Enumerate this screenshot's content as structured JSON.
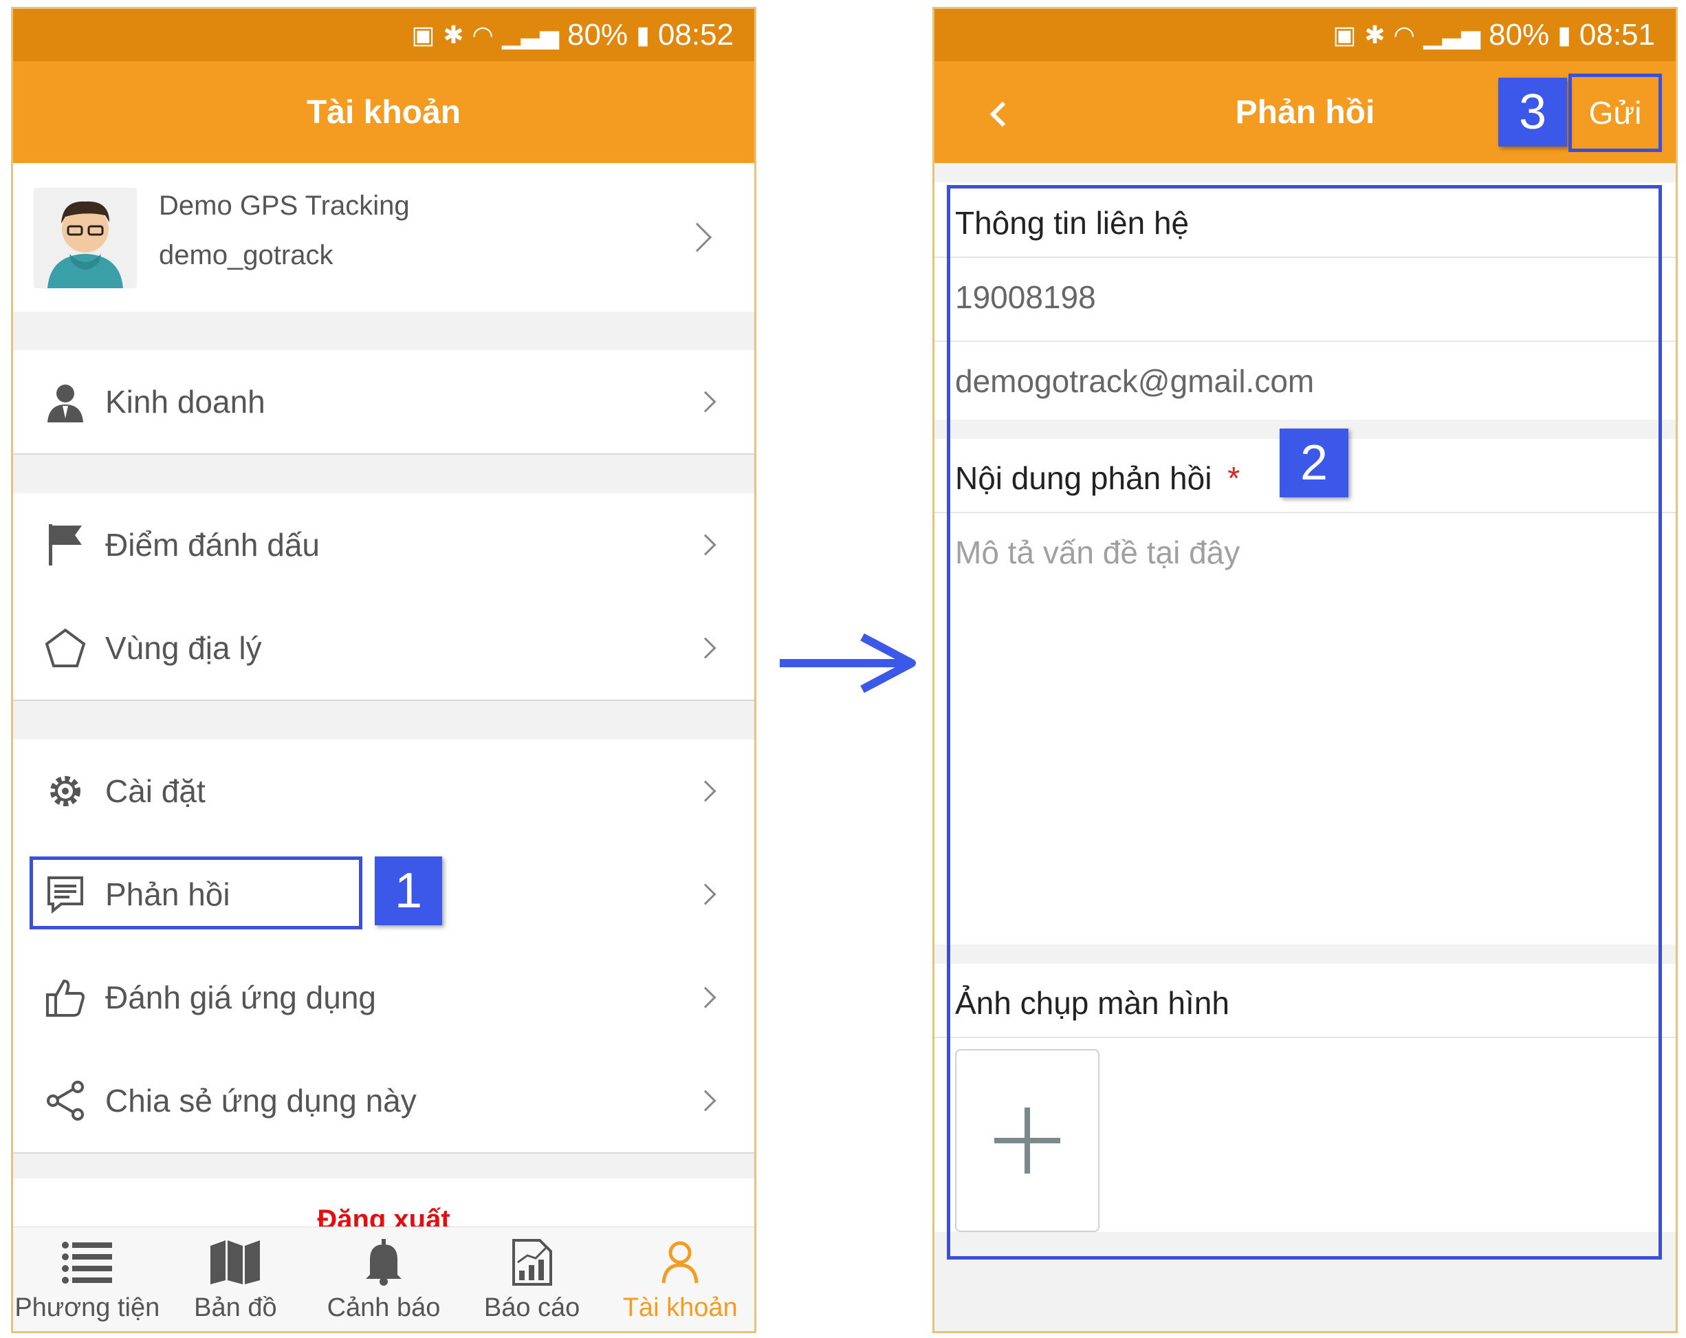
{
  "left": {
    "status": {
      "battery": "80%",
      "time": "08:52"
    },
    "title": "Tài khoản",
    "profile": {
      "name": "Demo GPS Tracking",
      "username": "demo_gotrack"
    },
    "menu": {
      "business": "Kinh doanh",
      "markers": "Điểm đánh dấu",
      "geofence": "Vùng địa lý",
      "settings": "Cài đặt",
      "feedback": "Phản hồi",
      "rate": "Đánh giá ứng dụng",
      "share": "Chia sẻ ứng dụng này"
    },
    "logout": "Đăng xuất",
    "tabs": [
      "Phương tiện",
      "Bản đồ",
      "Cảnh báo",
      "Báo cáo",
      "Tài khoản"
    ],
    "step_badge": "1"
  },
  "right": {
    "status": {
      "battery": "80%",
      "time": "08:51"
    },
    "title": "Phản hồi",
    "send": "Gửi",
    "contact_header": "Thông tin liên hệ",
    "phone": "19008198",
    "email": "demogotrack@gmail.com",
    "content_header": "Nội dung phản hồi",
    "required_mark": "*",
    "content_placeholder": "Mô tả vấn đề tại đây",
    "screenshot_header": "Ảnh chụp màn hình",
    "step_badge_2": "2",
    "step_badge_3": "3"
  },
  "colors": {
    "accent": "#f39c21",
    "statusbar": "#e0870d",
    "annotation": "#3b58e8",
    "required": "#e02020",
    "logout": "#e01010"
  }
}
